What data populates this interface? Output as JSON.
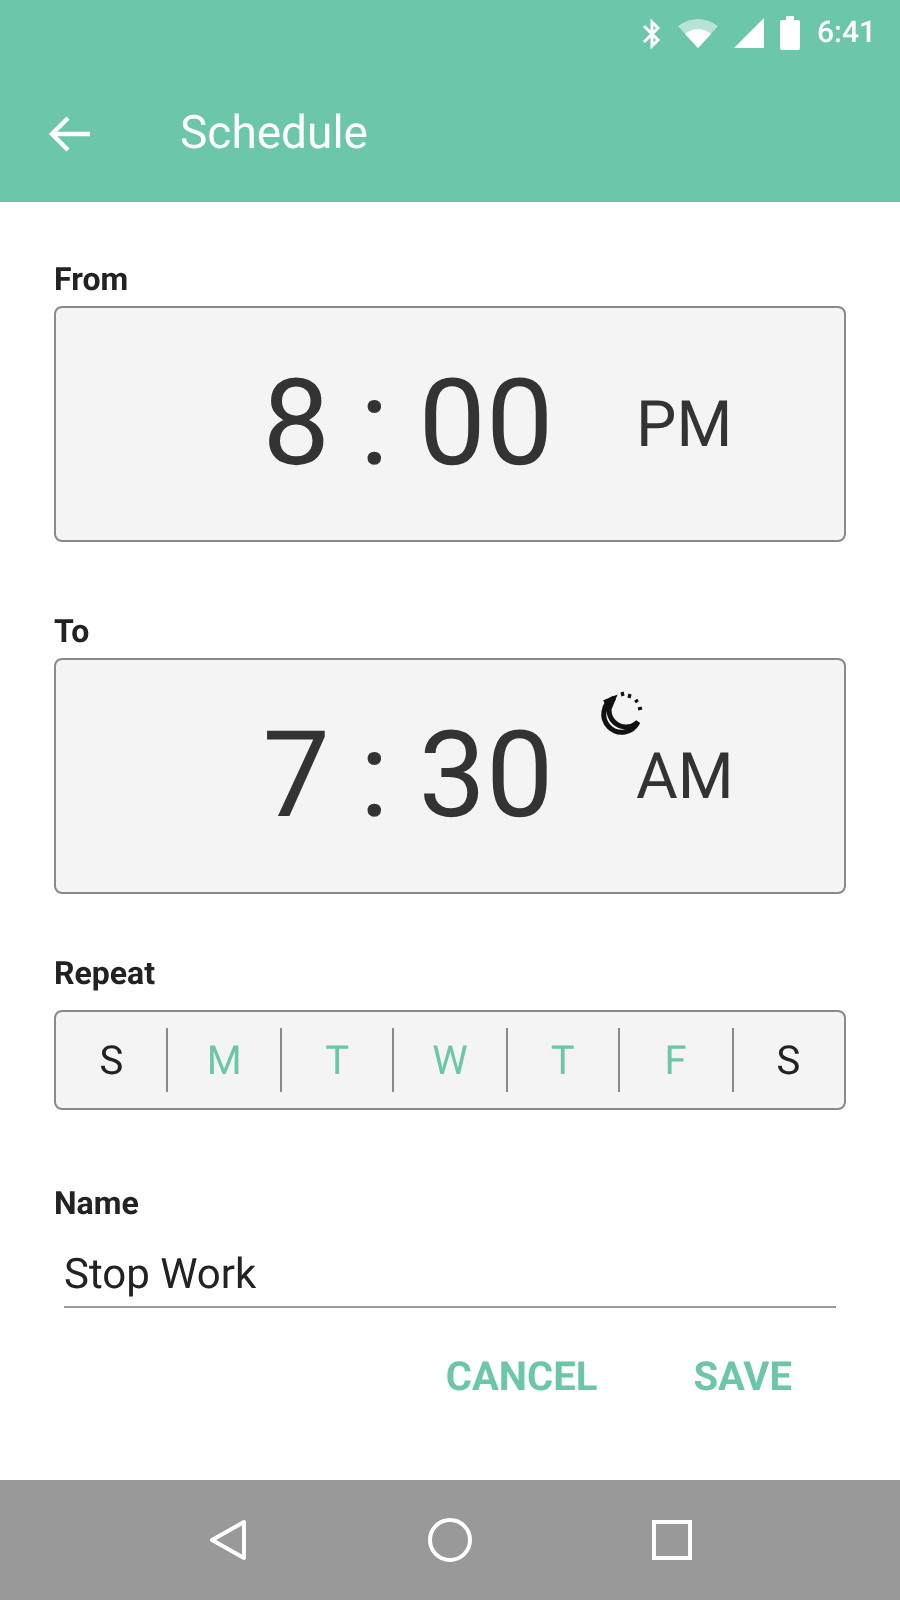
{
  "status_bar": {
    "time": "6:41"
  },
  "toolbar": {
    "title": "Schedule"
  },
  "times": [
    {
      "label": "From",
      "time": "8 : 00",
      "period": "PM",
      "overnight": false
    },
    {
      "label": "To",
      "time": "7 : 30",
      "period": "AM",
      "overnight": true
    }
  ],
  "repeat": {
    "label": "Repeat",
    "days": [
      {
        "label": "S",
        "selected": false
      },
      {
        "label": "M",
        "selected": true
      },
      {
        "label": "T",
        "selected": true
      },
      {
        "label": "W",
        "selected": true
      },
      {
        "label": "T",
        "selected": true
      },
      {
        "label": "F",
        "selected": true
      },
      {
        "label": "S",
        "selected": false
      }
    ]
  },
  "name": {
    "label": "Name",
    "value": "Stop Work"
  },
  "buttons": [
    "CANCEL",
    "SAVE"
  ]
}
